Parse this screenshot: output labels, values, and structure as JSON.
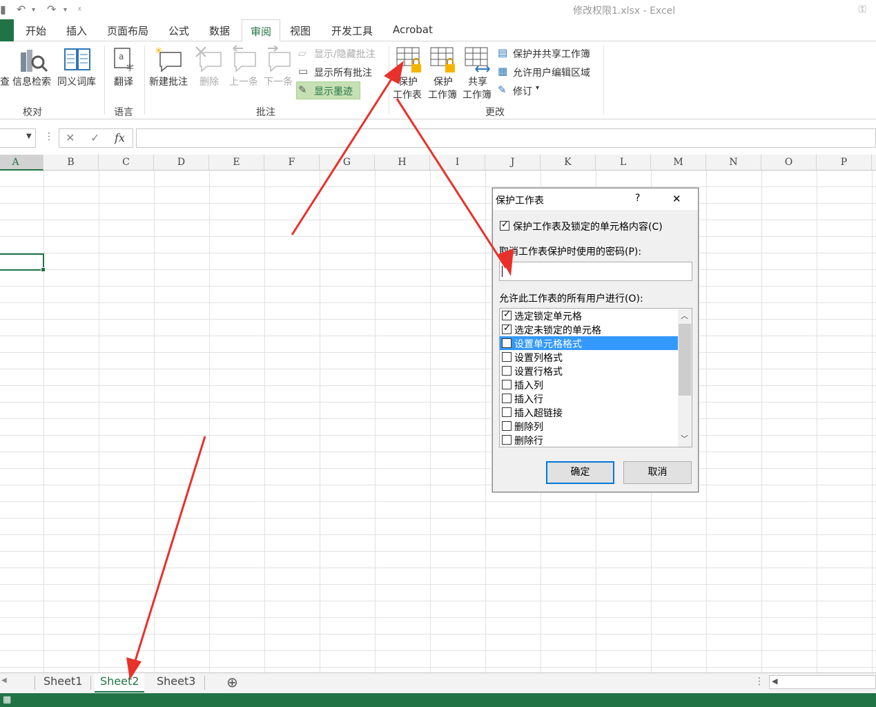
{
  "titlebar": {
    "title": "修改权限1.xlsx - Excel"
  },
  "tabs": [
    {
      "label": "开始"
    },
    {
      "label": "插入"
    },
    {
      "label": "页面布局"
    },
    {
      "label": "公式"
    },
    {
      "label": "数据"
    },
    {
      "label": "审阅"
    },
    {
      "label": "视图"
    },
    {
      "label": "开发工具"
    },
    {
      "label": "Acrobat"
    }
  ],
  "ribbon": {
    "proofing": {
      "partial_label": "查",
      "research": "信息检索",
      "thesaurus": "同义词库",
      "group": "校对"
    },
    "language": {
      "translate": "翻译",
      "group": "语言"
    },
    "comments": {
      "new": "新建批注",
      "delete": "删除",
      "prev": "上一条",
      "next": "下一条",
      "show_hide": "显示/隐藏批注",
      "show_all": "显示所有批注",
      "show_ink": "显示墨迹",
      "group": "批注"
    },
    "changes": {
      "protect_sheet_1": "保护",
      "protect_sheet_2": "工作表",
      "protect_book_1": "保护",
      "protect_book_2": "工作簿",
      "share_book_1": "共享",
      "share_book_2": "工作簿",
      "protect_share": "保护并共享工作簿",
      "allow_edit": "允许用户编辑区域",
      "track": "修订",
      "group": "更改"
    }
  },
  "formula_bar": {
    "cancel": "✕",
    "enter": "✓",
    "fx": "fx"
  },
  "columns": [
    "A",
    "B",
    "C",
    "D",
    "E",
    "F",
    "G",
    "H",
    "I",
    "J",
    "K",
    "L",
    "M",
    "N",
    "O",
    "P"
  ],
  "sheets": [
    {
      "name": "Sheet1"
    },
    {
      "name": "Sheet2"
    },
    {
      "name": "Sheet3"
    }
  ],
  "dialog": {
    "title": "保护工作表",
    "help": "?",
    "close": "✕",
    "protect_checkbox": "保护工作表及锁定的单元格内容(C)",
    "password_label": "取消工作表保护时使用的密码(P):",
    "password_value": "",
    "allow_label": "允许此工作表的所有用户进行(O):",
    "items": [
      {
        "label": "选定锁定单元格",
        "checked": true
      },
      {
        "label": "选定未锁定的单元格",
        "checked": true
      },
      {
        "label": "设置单元格格式",
        "checked": false
      },
      {
        "label": "设置列格式",
        "checked": false
      },
      {
        "label": "设置行格式",
        "checked": false
      },
      {
        "label": "插入列",
        "checked": false
      },
      {
        "label": "插入行",
        "checked": false
      },
      {
        "label": "插入超链接",
        "checked": false
      },
      {
        "label": "删除列",
        "checked": false
      },
      {
        "label": "删除行",
        "checked": false
      }
    ],
    "ok": "确定",
    "cancel": "取消"
  },
  "colors": {
    "accent": "#217346",
    "arrow": "#e8312a",
    "selection": "#3399ff"
  }
}
